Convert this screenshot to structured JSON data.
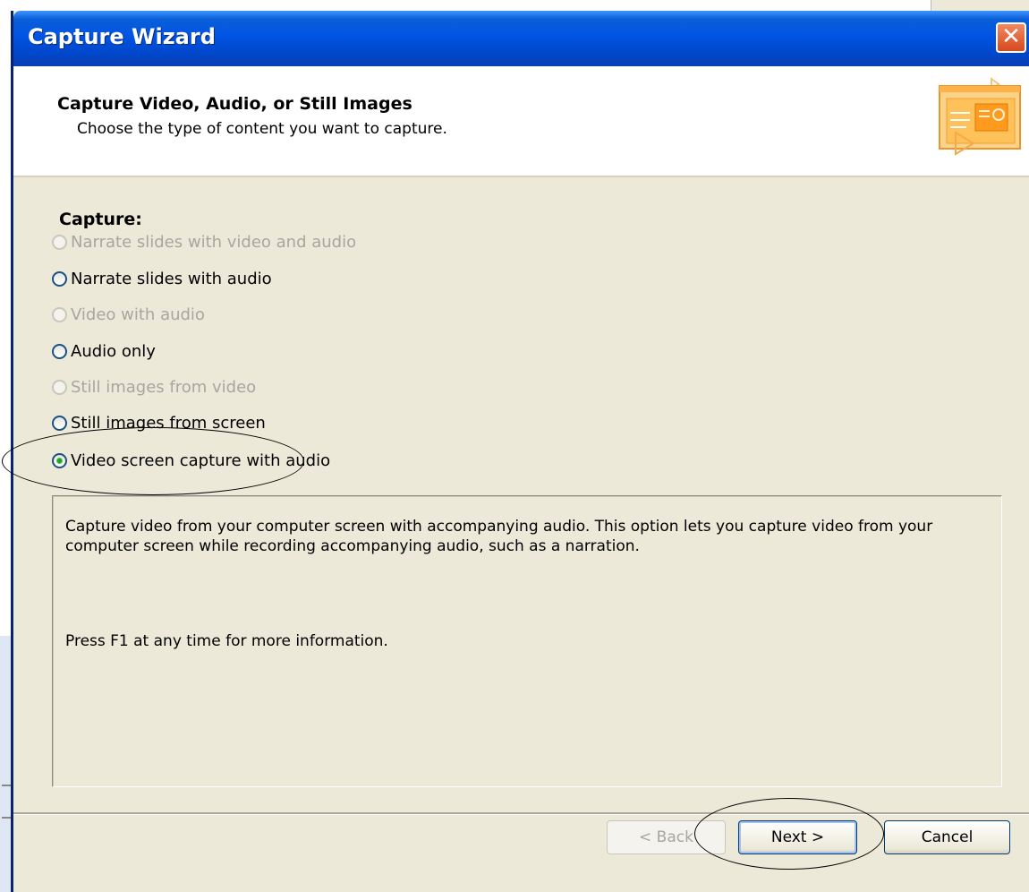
{
  "window": {
    "title": "Capture Wizard"
  },
  "header": {
    "title": "Capture Video, Audio, or Still Images",
    "subtitle": "Choose the type of content you want to capture."
  },
  "capture": {
    "label": "Capture:",
    "options": [
      {
        "label": "Narrate slides with video and audio",
        "enabled": false,
        "selected": false
      },
      {
        "label": "Narrate slides with audio",
        "enabled": true,
        "selected": false
      },
      {
        "label": "Video with audio",
        "enabled": false,
        "selected": false
      },
      {
        "label": "Audio only",
        "enabled": true,
        "selected": false
      },
      {
        "label": "Still images from video",
        "enabled": false,
        "selected": false
      },
      {
        "label": "Still images from screen",
        "enabled": true,
        "selected": false
      },
      {
        "label": "Video screen capture with audio",
        "enabled": true,
        "selected": true
      }
    ]
  },
  "description": {
    "text": "Capture video from your computer screen with accompanying audio. This option lets you capture video from your computer screen while recording accompanying audio, such as a narration.",
    "help": "Press F1 at any time for more information."
  },
  "buttons": {
    "back": "< Back",
    "next": "Next >",
    "cancel": "Cancel"
  },
  "colors": {
    "titlebar": "#0054e3",
    "dialog_bg": "#ece9d8",
    "close": "#d8481c",
    "radio_dot": "#21a121"
  },
  "icons": {
    "close": "close-icon",
    "header": "presentation-capture-icon"
  }
}
